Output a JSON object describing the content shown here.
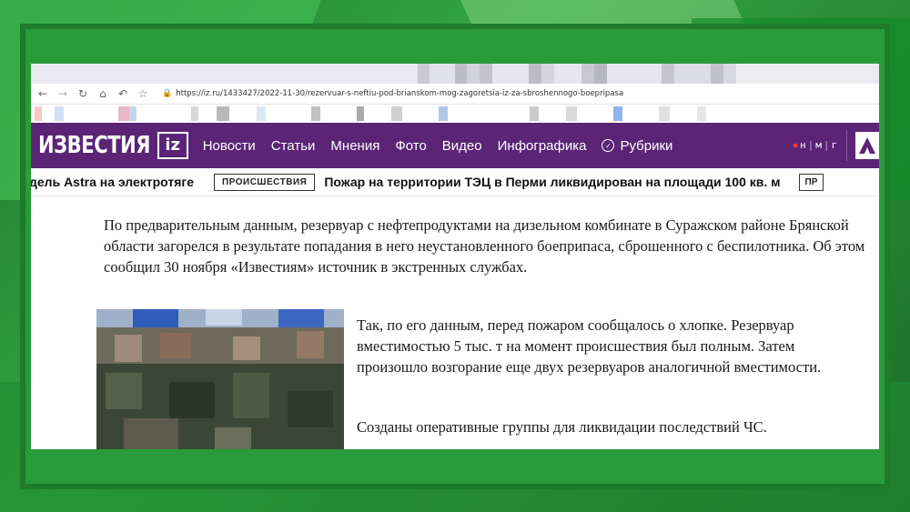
{
  "browser": {
    "url": "https://iz.ru/1433427/2022-11-30/rezervuar-s-neftiu-pod-brianskom-mog-zagoretsia-iz-za-sbroshennogo-boepripasa"
  },
  "site": {
    "logo_text": "ИЗВЕСТИЯ",
    "logo_badge": "iz",
    "nav": [
      "Новости",
      "Статьи",
      "Мнения",
      "Фото",
      "Видео",
      "Инфографика"
    ],
    "rubriki": "Рубрики",
    "nmg": [
      "н",
      "м",
      "г"
    ],
    "right_logo": "Æ"
  },
  "ticker": {
    "left_text": "дель Astra на электротяге",
    "badge": "ПРОИСШЕСТВИЯ",
    "headline": "Пожар на территории ТЭЦ в Перми ликвидирован на площади 100 кв. м",
    "badge_cut": "ПР"
  },
  "article": {
    "p1": "По предварительным данным, резервуар с нефтепродуктами на дизельном комбинате в Суражском районе Брянской области загорелся в результате попадания в него неустановленного боеприпаса, сброшенного с беспилотника. Об этом сообщил 30 ноября «Известиям» источник в экстренных службах.",
    "p2": "Так, по его данным, перед пожаром сообщалось о хлопке. Резервуар вместимостью 5 тыс. т на момент происшествия был полным. Затем произошло возгорание еще двух резервуаров аналогичной вместимости.",
    "p3": "Созданы оперативные группы для ликвидации последствий ЧС."
  },
  "colors": {
    "nav_bg": "#5b2477",
    "backdrop": "#2f9a3a"
  }
}
